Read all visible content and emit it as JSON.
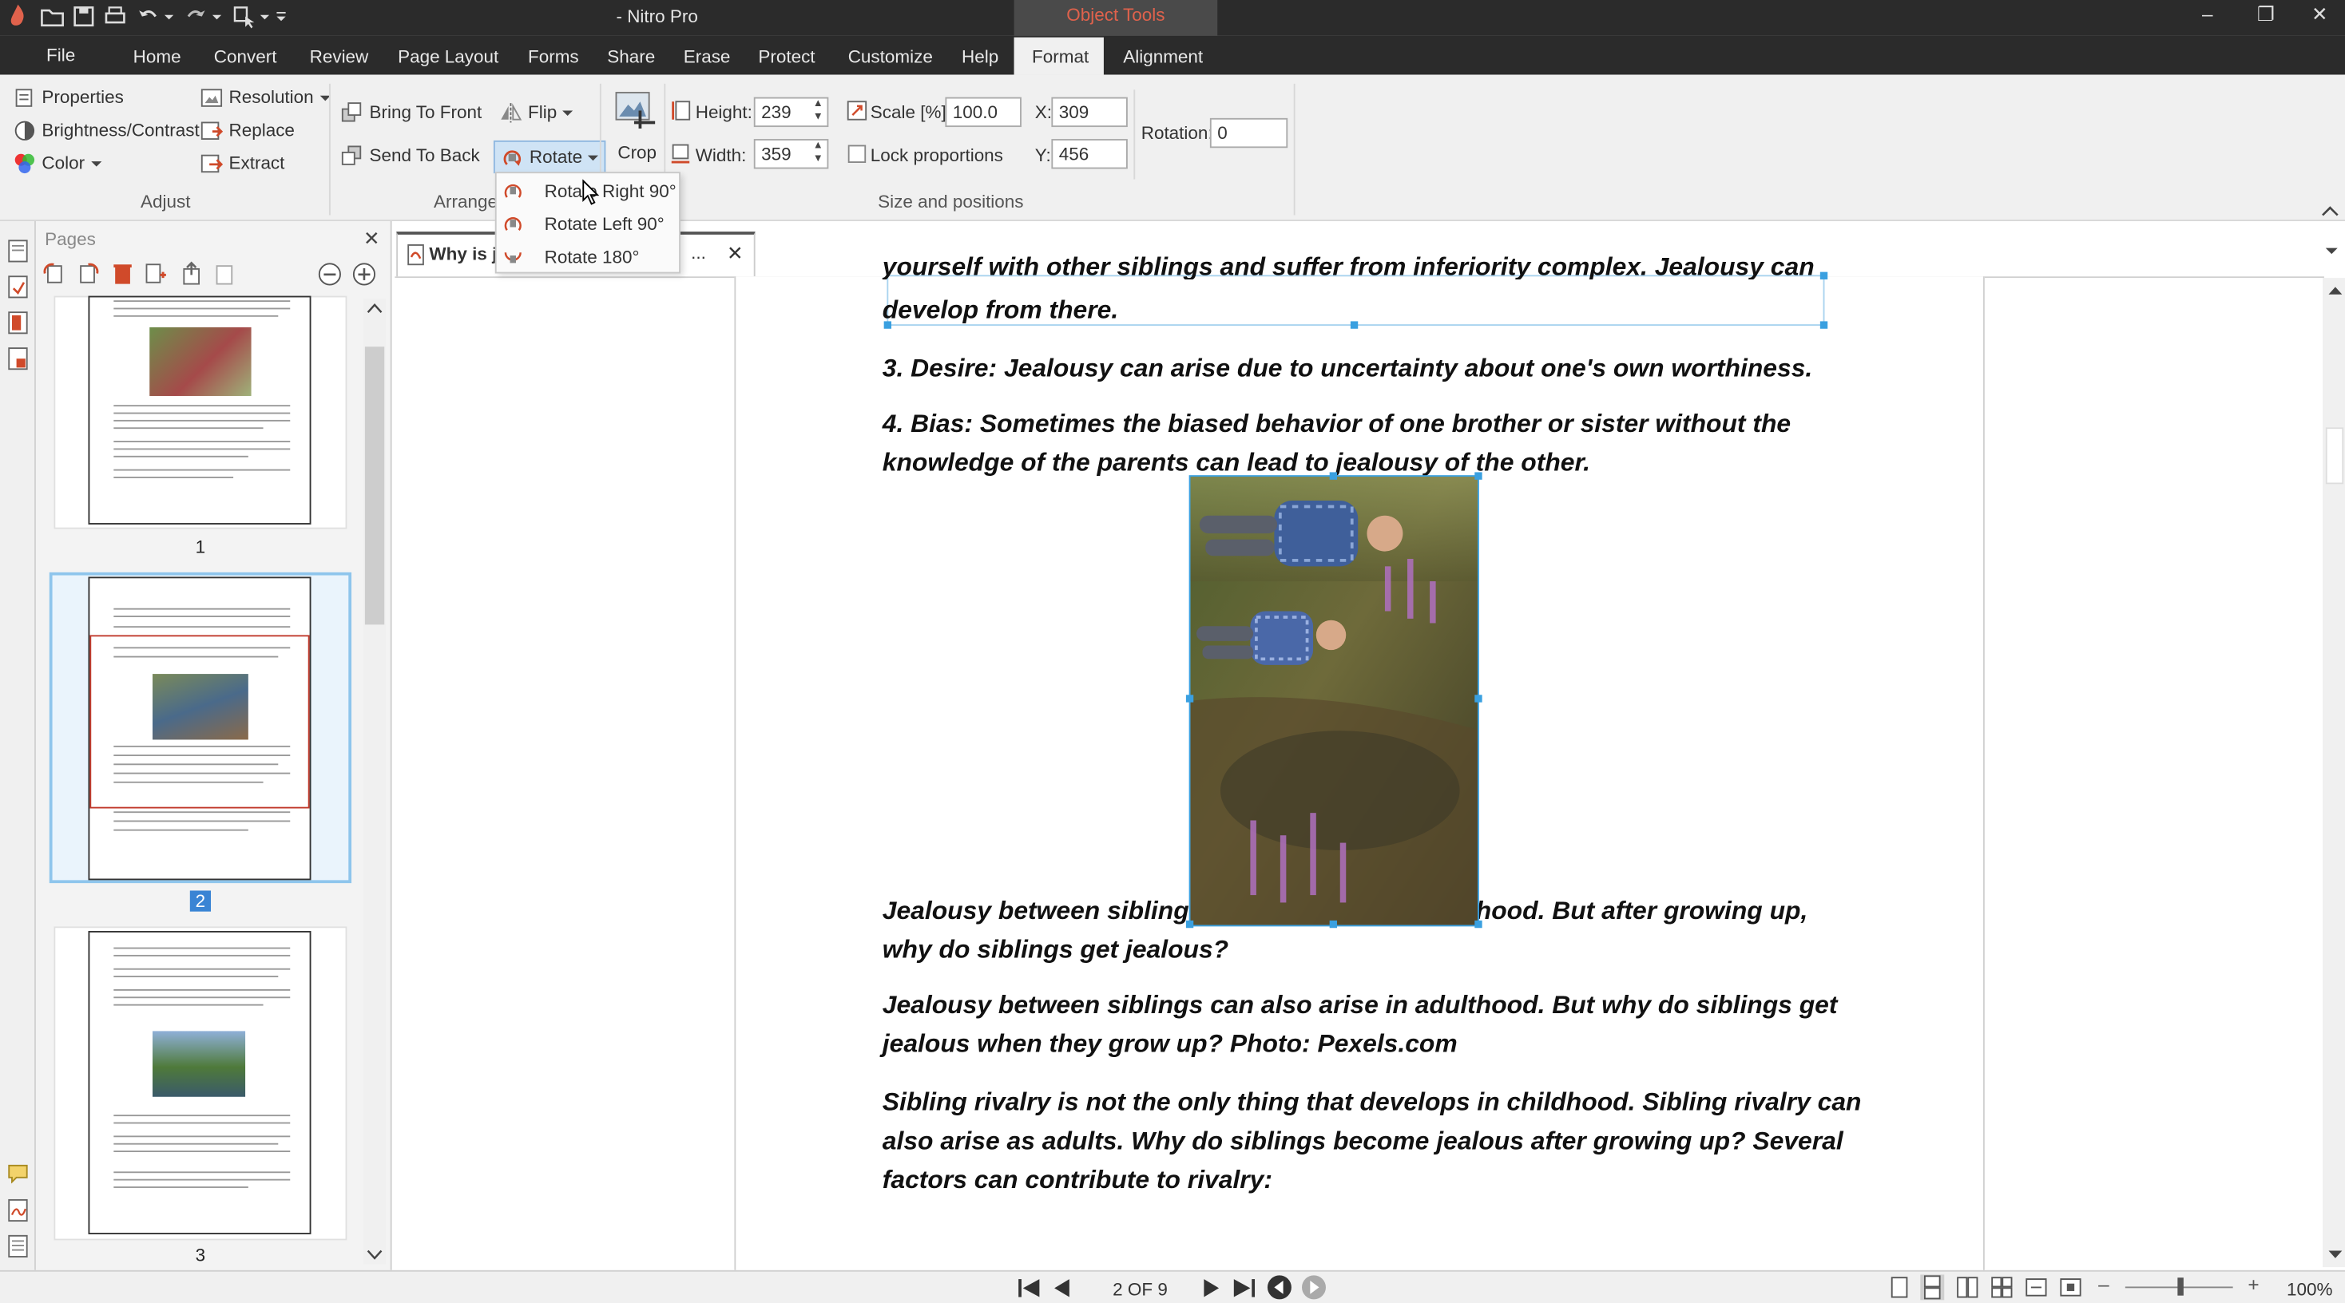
{
  "titlebar": {
    "app_title": "- Nitro Pro",
    "context_tab": "Object Tools",
    "window_controls": {
      "minimize": "–",
      "restore": "❐",
      "close": "✕"
    }
  },
  "menu": {
    "tabs": [
      "File",
      "Home",
      "Convert",
      "Review",
      "Page Layout",
      "Forms",
      "Share",
      "Erase",
      "Protect",
      "Customize",
      "Help",
      "Format",
      "Alignment"
    ],
    "active_tab": "Format"
  },
  "ribbon": {
    "adjust": {
      "properties": "Properties",
      "brightness_contrast": "Brightness/Contrast",
      "color": "Color",
      "resolution": "Resolution",
      "replace": "Replace",
      "extract": "Extract",
      "group_label": "Adjust"
    },
    "arrange": {
      "bring_to_front": "Bring To Front",
      "send_to_back": "Send To Back",
      "flip": "Flip",
      "rotate": "Rotate",
      "group_label": "Arrange"
    },
    "crop": {
      "label": "Crop"
    },
    "size": {
      "height_label": "Height:",
      "height_value": "239",
      "width_label": "Width:",
      "width_value": "359",
      "scale_label": "Scale [%]:",
      "scale_value": "100.0",
      "lock_label": "Lock proportions",
      "x_label": "X:",
      "x_value": "309",
      "y_label": "Y:",
      "y_value": "456",
      "rotation_label": "Rotation:",
      "rotation_value": "0",
      "group_label": "Size and positions"
    }
  },
  "rotate_menu": {
    "items": [
      "Rotate Right 90°",
      "Rotate Left 90°",
      "Rotate 180°"
    ]
  },
  "pages_panel": {
    "title": "Pages",
    "close": "✕",
    "page_numbers": [
      "1",
      "2",
      "3"
    ],
    "selected_page": "2"
  },
  "document_tab": {
    "title": "Why is j",
    "ellipsis": "...",
    "close": "✕"
  },
  "document": {
    "paragraphs": [
      "yourself with other siblings and suffer from inferiority complex. Jealousy can",
      "develop from there.",
      "3. Desire: Jealousy can arise due to uncertainty about one's own worthiness.",
      "4. Bias: Sometimes the biased behavior of one brother or sister without the",
      "knowledge of the parents can lead to jealousy of the other.",
      "Jealousy between siblings can also arise in adulthood. But after growing up,",
      "why do siblings get jealous?",
      "Jealousy between siblings can also arise in adulthood. But why do siblings get",
      "jealous when they grow up? Photo: Pexels.com",
      "Sibling rivalry is not the only thing that develops in childhood. Sibling rivalry can",
      "also arise as adults. Why do siblings become jealous after growing up? Several",
      "factors can contribute to rivalry:"
    ]
  },
  "statusbar": {
    "page_indicator": "2 OF 9",
    "zoom": "100%"
  },
  "colors": {
    "titlebar_bg": "#2b2b2b",
    "context_tab_text": "#e0624c",
    "ribbon_bg": "#f0f0f0",
    "selection_blue": "#3aa0e0",
    "thumb_selected_border": "#8ec5ec"
  }
}
